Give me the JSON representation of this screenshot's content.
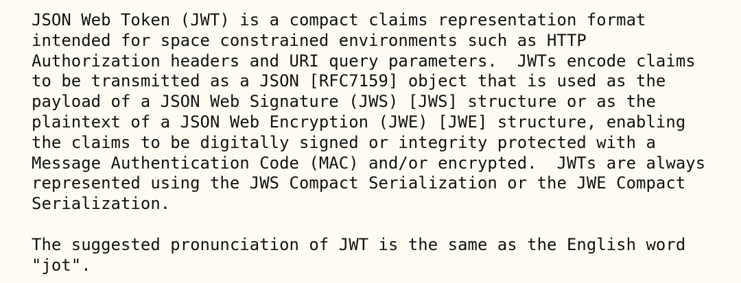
{
  "document": {
    "paragraphs": [
      {
        "lines": [
          "JSON Web Token (JWT) is a compact claims representation format",
          "intended for space constrained environments such as HTTP",
          "Authorization headers and URI query parameters.  JWTs encode claims",
          "to be transmitted as a JSON [RFC7159] object that is used as the",
          "payload of a JSON Web Signature (JWS) [JWS] structure or as the",
          "plaintext of a JSON Web Encryption (JWE) [JWE] structure, enabling",
          "the claims to be digitally signed or integrity protected with a",
          "Message Authentication Code (MAC) and/or encrypted.  JWTs are always",
          "represented using the JWS Compact Serialization or the JWE Compact",
          "Serialization."
        ]
      },
      {
        "lines": [
          "The suggested pronunciation of JWT is the same as the English word",
          "\"jot\"."
        ]
      }
    ]
  }
}
